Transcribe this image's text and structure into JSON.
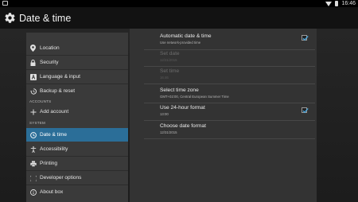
{
  "status_bar": {
    "time": "16:46"
  },
  "header": {
    "title": "Date & time",
    "icon": "gear-icon"
  },
  "sidebar": {
    "items": [
      {
        "label": "Location",
        "icon": "location-pin-icon"
      },
      {
        "label": "Security",
        "icon": "lock-icon"
      },
      {
        "label": "Language & input",
        "icon": "keyboard-a-icon"
      },
      {
        "label": "Backup & reset",
        "icon": "backup-restore-icon"
      }
    ],
    "accounts_header": "ACCOUNTS",
    "add_account": {
      "label": "Add account",
      "icon": "plus-icon"
    },
    "system_header": "SYSTEM",
    "system_items": [
      {
        "label": "Date & time",
        "icon": "clock-icon",
        "selected": true
      },
      {
        "label": "Accessibility",
        "icon": "accessibility-icon"
      },
      {
        "label": "Printing",
        "icon": "printer-icon"
      },
      {
        "label": "Developer options",
        "icon": "code-braces-icon"
      },
      {
        "label": "About box",
        "icon": "info-icon"
      }
    ]
  },
  "settings": {
    "automatic": {
      "title": "Automatic date & time",
      "summary": "Use network-provided time",
      "checked": true
    },
    "set_date": {
      "title": "Set date",
      "summary": "12/31/2015",
      "enabled": false
    },
    "set_time": {
      "title": "Set time",
      "summary": "16:46",
      "enabled": false
    },
    "time_zone": {
      "title": "Select time zone",
      "summary": "GMT+02:00, Central European Summer Time"
    },
    "format24": {
      "title": "Use 24-hour format",
      "summary": "13:00",
      "checked": true
    },
    "date_format": {
      "title": "Choose date format",
      "summary": "12/31/2015"
    }
  },
  "colors": {
    "accent": "#2b6e98",
    "check": "#4aa3d8"
  }
}
